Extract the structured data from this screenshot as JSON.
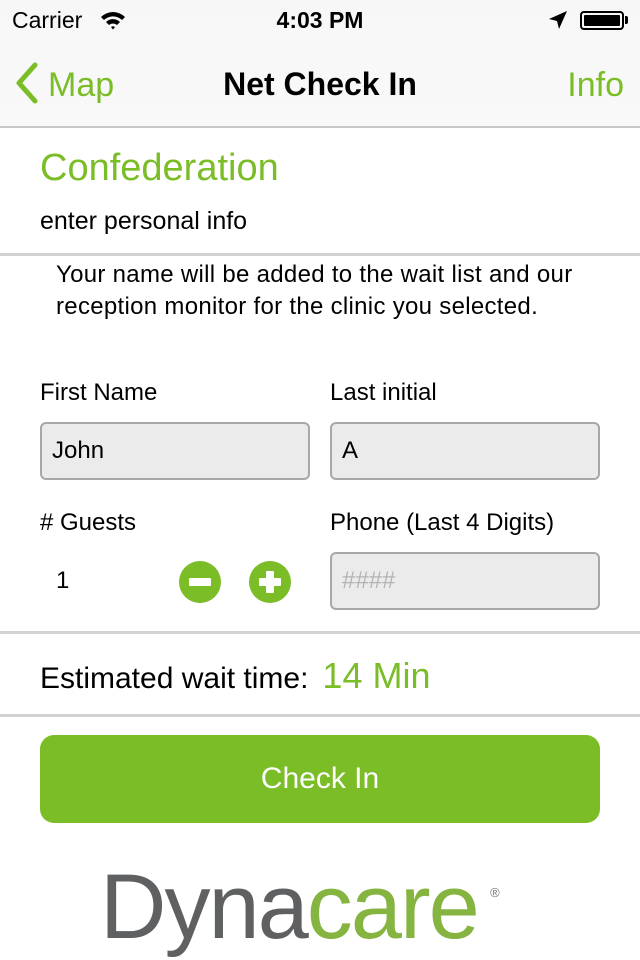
{
  "status_bar": {
    "carrier": "Carrier",
    "time": "4:03 PM",
    "icons": [
      "wifi-icon",
      "location-arrow-icon",
      "battery-icon"
    ]
  },
  "nav": {
    "back_label": "Map",
    "back_icon": "chevron-left-icon",
    "title": "Net Check In",
    "right_label": "Info"
  },
  "clinic": {
    "name": "Confederation",
    "subtitle": "enter personal info"
  },
  "description": "Your name will be added to the wait list and our reception monitor for the clinic you selected.",
  "form": {
    "first_name": {
      "label": "First Name",
      "value": "John"
    },
    "last_initial": {
      "label": "Last initial",
      "value": "A"
    },
    "guests": {
      "label": "# Guests",
      "value": "1",
      "decrement_icon": "minus-circle-icon",
      "increment_icon": "plus-circle-icon"
    },
    "phone": {
      "label": "Phone (Last 4 Digits)",
      "value": "",
      "placeholder": "####"
    }
  },
  "wait": {
    "label": "Estimated wait time:",
    "value": "14 Min"
  },
  "check_in_button": "Check In",
  "logo": {
    "part1": "Dyna",
    "part2": "care",
    "mark": "®"
  },
  "colors": {
    "accent": "#7abd26",
    "logo_gray": "#5f6062",
    "logo_green": "#85b440",
    "field_bg": "#ebebeb"
  }
}
